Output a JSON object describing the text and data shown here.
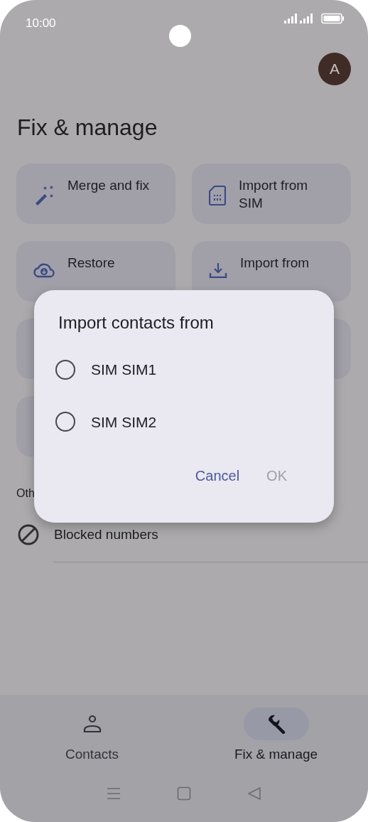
{
  "status_bar": {
    "time": "10:00"
  },
  "avatar": {
    "initial": "A"
  },
  "title": "Fix & manage",
  "actions": [
    {
      "kind": "merge",
      "label": "Merge and fix"
    },
    {
      "kind": "sim",
      "label": "Import from SIM"
    },
    {
      "kind": "restore",
      "label": "Restore"
    },
    {
      "kind": "file",
      "label": "Import from"
    },
    {
      "kind": "covered"
    },
    {
      "kind": "covered"
    },
    {
      "kind": "covered"
    }
  ],
  "other_heading": "Oth",
  "list": [
    {
      "kind": "blocked",
      "label": "Blocked numbers"
    }
  ],
  "bottom_nav": [
    {
      "kind": "person",
      "label": "Contacts",
      "selected": false
    },
    {
      "kind": "wrench",
      "label": "Fix & manage",
      "selected": true
    }
  ],
  "dialog": {
    "title": "Import contacts from",
    "options": [
      {
        "label": "SIM SIM1",
        "selected": false
      },
      {
        "label": "SIM SIM2",
        "selected": false
      }
    ],
    "buttons": [
      {
        "label": "Cancel",
        "disabled": false
      },
      {
        "label": "OK",
        "disabled": true
      }
    ]
  }
}
